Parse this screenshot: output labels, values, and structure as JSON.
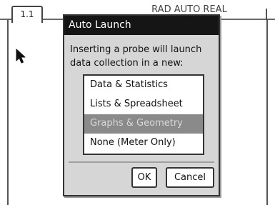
{
  "header": {
    "tab_label": "1.1",
    "document_title": "RAD AUTO REAL"
  },
  "dialog": {
    "title": "Auto Launch",
    "message_line1": "Inserting a probe will launch",
    "message_line2": "data collection in a new:",
    "options": [
      {
        "label": "Data & Statistics",
        "selected": false
      },
      {
        "label": "Lists & Spreadsheet",
        "selected": false
      },
      {
        "label": "Graphs & Geometry",
        "selected": true
      },
      {
        "label": "None (Meter Only)",
        "selected": false
      }
    ],
    "ok_label": "OK",
    "cancel_label": "Cancel"
  },
  "colors": {
    "title_bar": "#151515",
    "dialog_bg": "#d6d6d6",
    "selection": "#8a8a8a"
  },
  "icons": {
    "cursor": "mouse-pointer-icon"
  }
}
